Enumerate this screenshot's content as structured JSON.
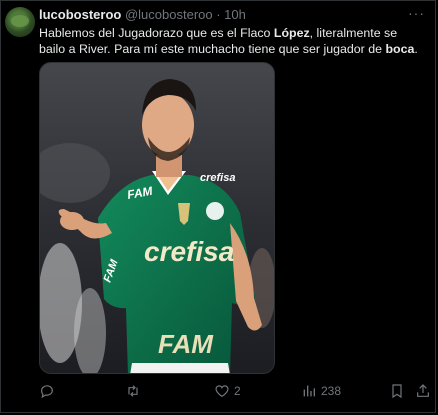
{
  "tweet": {
    "display_name": "lucobosteroo",
    "handle": "@lucobosteroo",
    "separator": " · ",
    "time": "10h",
    "more": "···",
    "text_parts": {
      "p1": "Hablemos del Jugadorazo que es el Flaco ",
      "p2": "López",
      "p3": ", literalmente se bailo a River. Para mí este muchacho tiene que ser jugador de ",
      "p4": "boca",
      "p5": "."
    }
  },
  "jersey": {
    "sponsor": "crefisa",
    "sponsor_small": "crefisa",
    "brand": "FAM",
    "brand_sleeve": "FAM",
    "brand_bottom": "FAM"
  },
  "actions": {
    "reply_count": "",
    "retweet_count": "",
    "like_count": "2",
    "views_count": "238"
  },
  "colors": {
    "jersey": "#0e6b48",
    "background": "#000000",
    "muted": "#71767b"
  }
}
